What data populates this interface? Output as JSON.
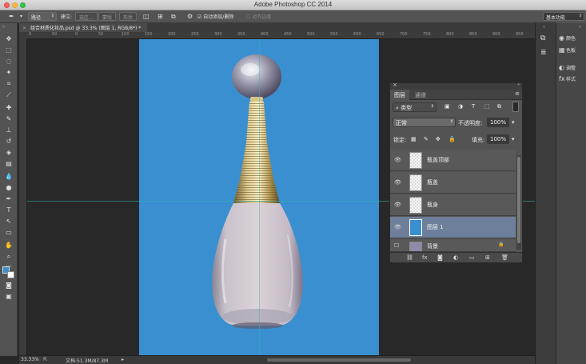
{
  "window": {
    "title": "Adobe Photoshop CC 2014"
  },
  "colors": {
    "canvas_bg": "#3a8fd0",
    "selected_layer": "#6e7f9b",
    "guide": "#2fb5b5"
  },
  "options_bar": {
    "tool_icon": "pen-tool-icon",
    "mode_value": "路径",
    "build_label": "建立:",
    "selection_button": "选区...",
    "mask_button": "蒙版",
    "shape_button": "形状",
    "auto_add_delete_label": "自动添加/删除",
    "auto_add_delete_checked": true,
    "align_edges_label": "对齐边缘",
    "align_edges_checked": false
  },
  "workspace_selector": {
    "value": "基本功能"
  },
  "document_tab": {
    "label": "组合材质化妆品.psd @ 33.3% (图层 1, RGB/8*) *"
  },
  "ruler": {
    "ticks": [
      "0",
      "50",
      "0",
      "50",
      "100",
      "150",
      "200",
      "250",
      "300",
      "350",
      "400",
      "450",
      "500",
      "550",
      "600",
      "650",
      "700",
      "750",
      "800",
      "850",
      "900",
      "950"
    ]
  },
  "status_bar": {
    "zoom": "33.33%",
    "doc_info": "文档:51.3M/87.3M"
  },
  "right_dock": {
    "items": [
      {
        "icon": "color-icon",
        "label": "颜色"
      },
      {
        "icon": "swatches-icon",
        "label": "色板"
      },
      {
        "icon": "adjustments-icon",
        "label": "调整"
      },
      {
        "icon": "styles-icon",
        "label": "样式"
      }
    ]
  },
  "layers_panel": {
    "tabs": [
      {
        "label": "图层",
        "active": true
      },
      {
        "label": "通道",
        "active": false
      }
    ],
    "filter_type": "类型",
    "blend_mode": "正常",
    "opacity_label": "不透明度:",
    "opacity_value": "100%",
    "lock_label": "锁定:",
    "fill_label": "填充:",
    "fill_value": "100%",
    "layers": [
      {
        "name": "瓶盖顶部",
        "visible": true,
        "selected": false
      },
      {
        "name": "瓶盖",
        "visible": true,
        "selected": false
      },
      {
        "name": "瓶身",
        "visible": true,
        "selected": false
      },
      {
        "name": "图层 1",
        "visible": true,
        "selected": true
      },
      {
        "name": "背景",
        "visible": false,
        "selected": false
      }
    ]
  }
}
